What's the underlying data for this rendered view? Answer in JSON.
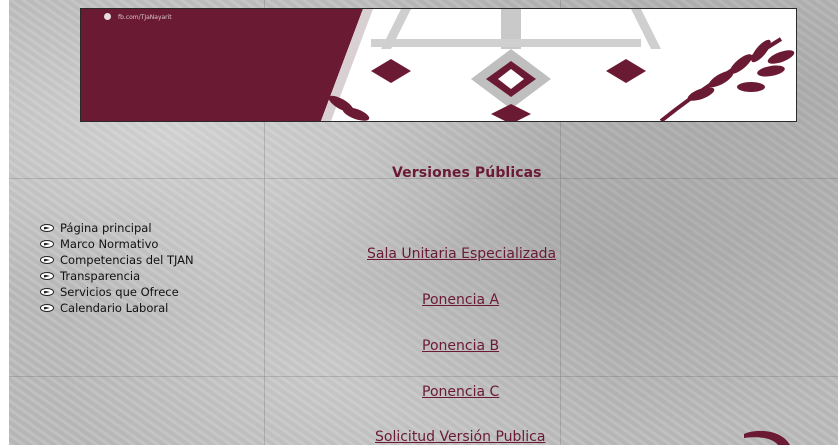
{
  "banner": {
    "social_text": "fb.com/TJaNayarit",
    "brand_color": "#6b1a34"
  },
  "page": {
    "title": "Versiones Públicas"
  },
  "nav": {
    "items": [
      {
        "label": "Página principal"
      },
      {
        "label": "Marco Normativo"
      },
      {
        "label": "Competencias del TJAN"
      },
      {
        "label": "Transparencia"
      },
      {
        "label": "Servicios que Ofrece"
      },
      {
        "label": "Calendario Laboral"
      }
    ]
  },
  "links": [
    {
      "label": "Sala Unitaria Especializada"
    },
    {
      "label": "Ponencia A"
    },
    {
      "label": "Ponencia B"
    },
    {
      "label": "Ponencia C"
    },
    {
      "label": "Solicitud Versión Publica"
    }
  ]
}
